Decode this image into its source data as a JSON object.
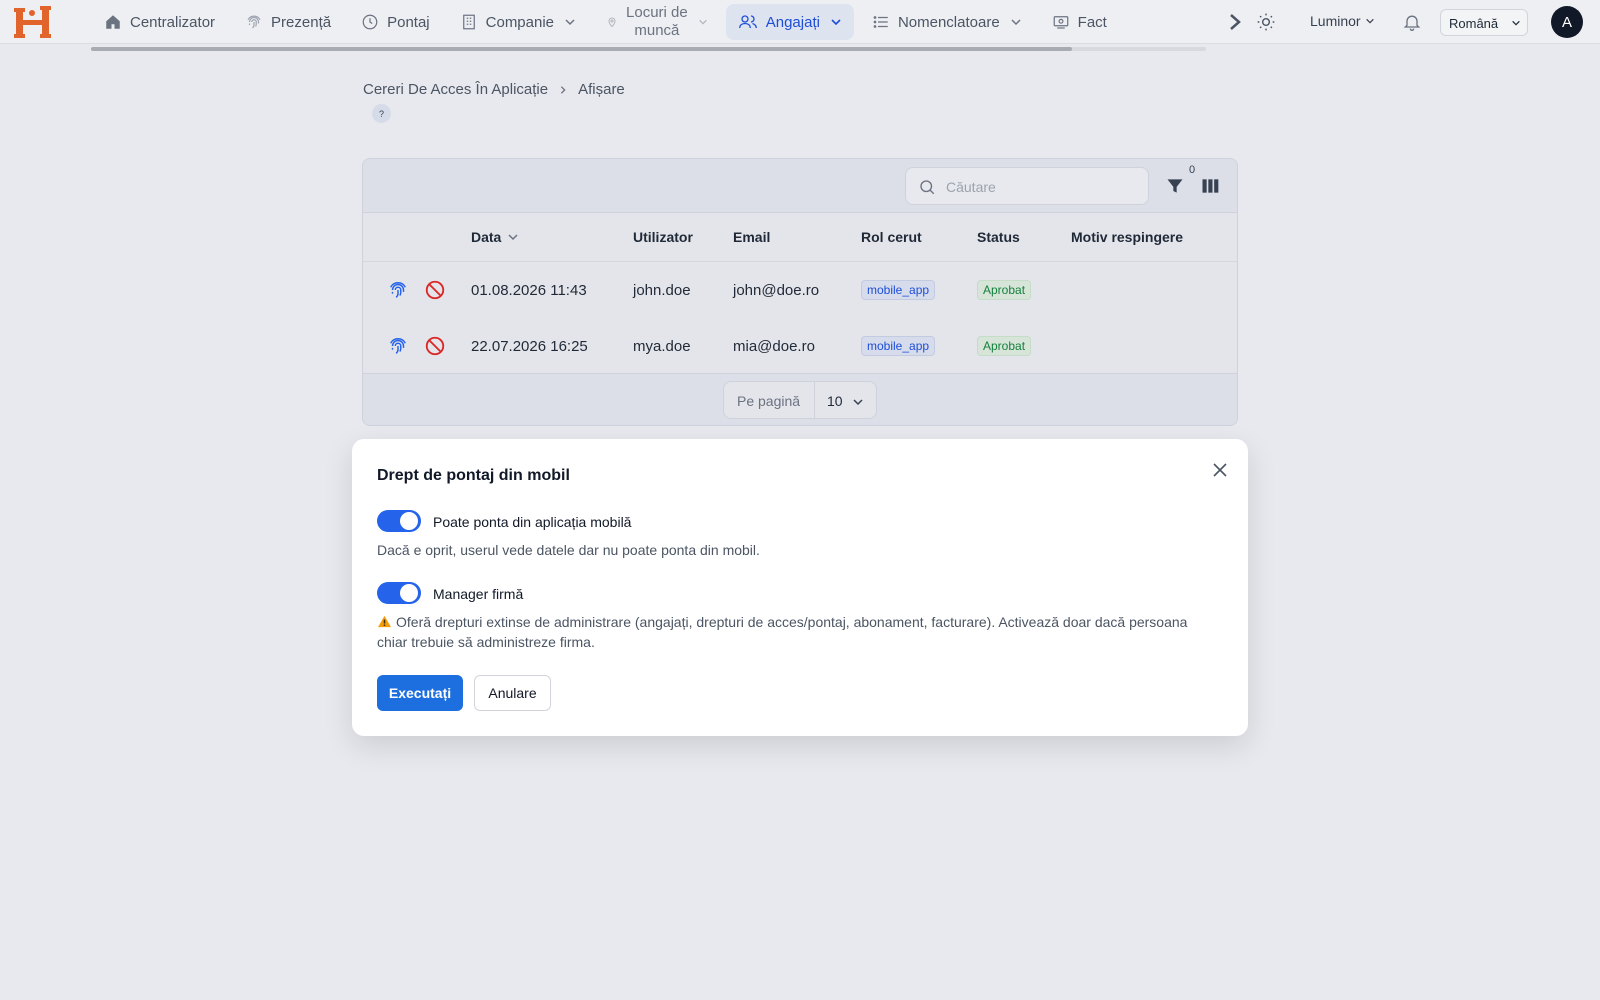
{
  "colors": {
    "accent": "#1d6fe0",
    "toggle_on": "#2563eb",
    "role_badge": "#1d4ed8",
    "status_badge": "#15803d",
    "danger": "#dc2626",
    "logo": "#e0642b"
  },
  "nav": {
    "items": [
      {
        "label": "Centralizator",
        "icon": "home-icon"
      },
      {
        "label": "Prezență",
        "icon": "fingerprint-icon"
      },
      {
        "label": "Pontaj",
        "icon": "clock-icon"
      },
      {
        "label": "Companie",
        "icon": "building-icon"
      },
      {
        "label_line1": "Locuri de",
        "label_line2": "muncă",
        "icon": "map-pin-icon"
      },
      {
        "label": "Angajați",
        "icon": "users-icon"
      },
      {
        "label": "Nomenclatoare",
        "icon": "list-icon"
      },
      {
        "label": "Fact",
        "icon": "billing-icon"
      }
    ],
    "theme_label": "Luminor",
    "language": "Română",
    "avatar_initial": "A",
    "progress_fraction": 0.88
  },
  "breadcrumb": {
    "parent": "Cereri De Acces În Aplicație",
    "current": "Afișare",
    "help": "?"
  },
  "toolbar": {
    "search_placeholder": "Căutare",
    "filter_count": "0"
  },
  "table": {
    "headers": {
      "date": "Data",
      "user": "Utilizator",
      "email": "Email",
      "role": "Rol cerut",
      "status": "Status",
      "reason": "Motiv respingere"
    },
    "rows": [
      {
        "date": "01.08.2026 11:43",
        "user": "john.doe",
        "email": "john@doe.ro",
        "role": "mobile_app",
        "status": "Aprobat",
        "reason": ""
      },
      {
        "date": "22.07.2026 16:25",
        "user": "mya.doe",
        "email": "mia@doe.ro",
        "role": "mobile_app",
        "status": "Aprobat",
        "reason": ""
      }
    ],
    "per_page_label": "Pe pagină",
    "per_page_value": "10"
  },
  "modal": {
    "title": "Drept de pontaj din mobil",
    "option1_label": "Poate ponta din aplicația mobilă",
    "option1_desc": "Dacă e oprit, userul vede datele dar nu poate ponta din mobil.",
    "option1_on": true,
    "option2_label": "Manager firmă",
    "option2_desc": "Oferă drepturi extinse de administrare (angajați, drepturi de acces/pontaj, abonament, facturare). Activează doar dacă persoana chiar trebuie să administreze firma.",
    "option2_on": true,
    "execute_label": "Executați",
    "cancel_label": "Anulare"
  }
}
